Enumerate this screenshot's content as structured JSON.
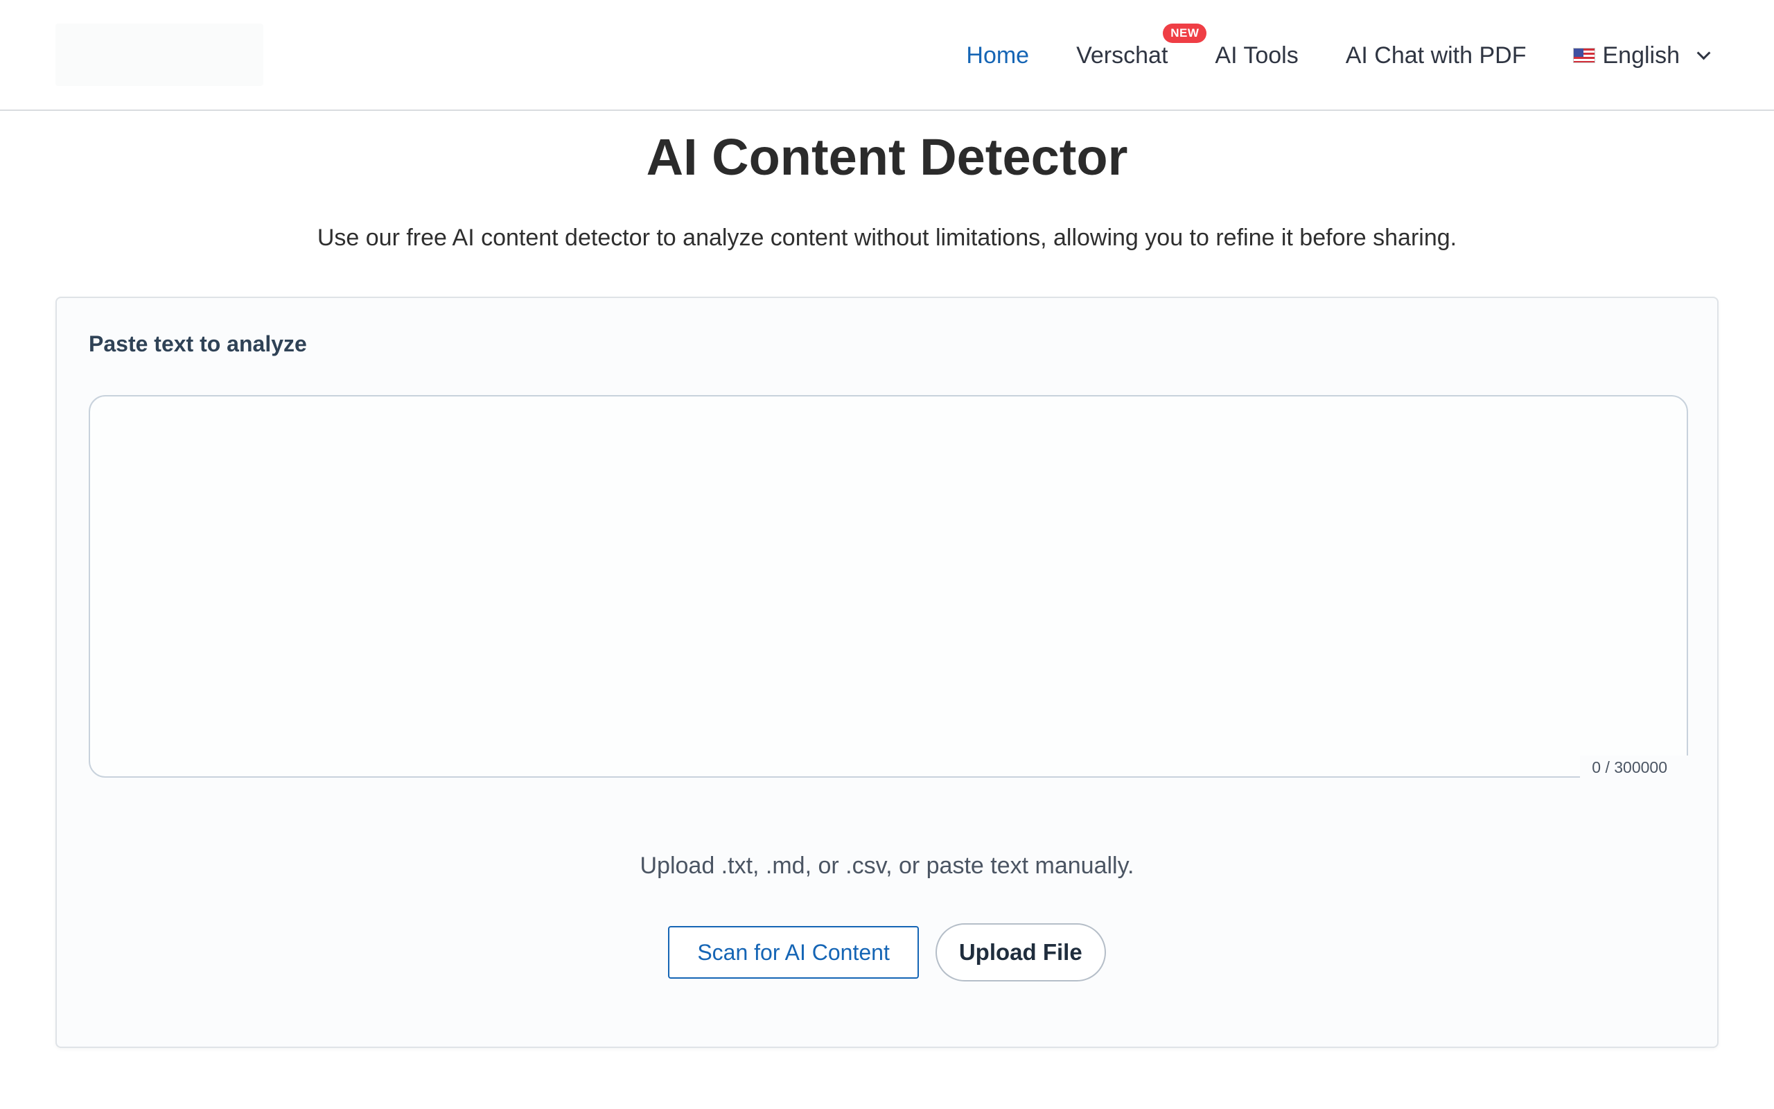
{
  "header": {
    "nav": {
      "home": "Home",
      "verschat": "Verschat",
      "verschat_badge": "NEW",
      "ai_tools": "AI Tools",
      "ai_chat_pdf": "AI Chat with PDF"
    },
    "language": {
      "selected": "English",
      "icon": "us-flag-icon"
    }
  },
  "hero": {
    "title": "AI Content Detector",
    "subtitle": "Use our free AI content detector to analyze content without limitations, allowing you to refine it before sharing."
  },
  "analyzer": {
    "label": "Paste text to analyze",
    "textarea_value": "",
    "char_count": "0 / 300000",
    "upload_hint": "Upload .txt, .md, or .csv, or paste text manually.",
    "scan_label": "Scan for AI Content",
    "upload_label": "Upload File"
  },
  "colors": {
    "accent": "#1565b5",
    "badge": "#ef3e45",
    "text": "#2d2d2d"
  }
}
